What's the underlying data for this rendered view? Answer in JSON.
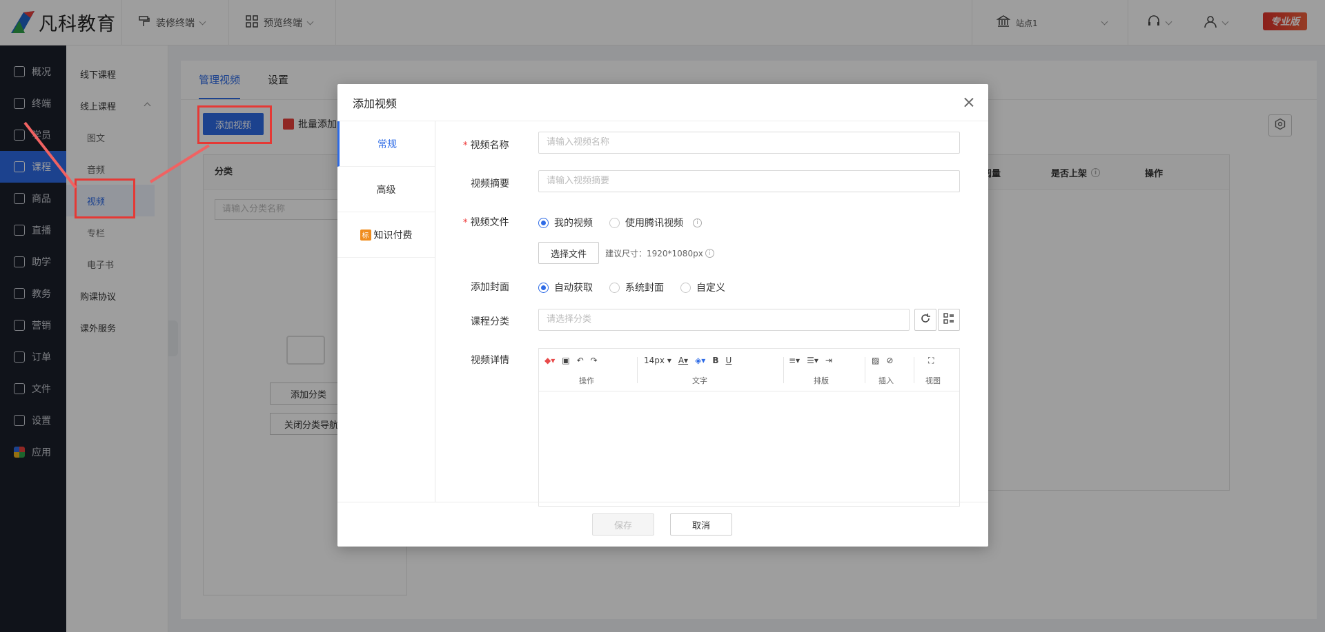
{
  "header": {
    "logo_text": "凡科教育",
    "decorate_label": "装修终端",
    "preview_label": "预览终端",
    "site_label": "站点1",
    "edition_badge": "专业版"
  },
  "nav": {
    "items": [
      {
        "label": "概况"
      },
      {
        "label": "终端"
      },
      {
        "label": "学员"
      },
      {
        "label": "课程"
      },
      {
        "label": "商品"
      },
      {
        "label": "直播"
      },
      {
        "label": "助学"
      },
      {
        "label": "教务"
      },
      {
        "label": "营销"
      },
      {
        "label": "订单"
      },
      {
        "label": "文件"
      },
      {
        "label": "设置"
      },
      {
        "label": "应用"
      }
    ],
    "active": "课程"
  },
  "subnav": {
    "offline": "线下课程",
    "online": "线上课程",
    "children": [
      "图文",
      "音频",
      "视频",
      "专栏",
      "电子书"
    ],
    "purchase": "购课协议",
    "extra": "课外服务"
  },
  "main": {
    "tabs": [
      "管理视频",
      "设置"
    ],
    "add_video": "添加视频",
    "batch_add": "批量添加",
    "category_header": "分类",
    "category_search_placeholder": "请输入分类名称",
    "add_category": "添加分类",
    "close_category_nav": "关闭分类导航",
    "columns": [
      "实际订阅量",
      "是否上架",
      "操作"
    ]
  },
  "modal": {
    "title": "添加视频",
    "side_tabs": [
      "常规",
      "高级",
      "知识付费"
    ],
    "knowledge_tag": "标",
    "fields": {
      "name_label": "视频名称",
      "name_placeholder": "请输入视频名称",
      "summary_label": "视频摘要",
      "summary_placeholder": "请输入视频摘要",
      "file_label": "视频文件",
      "file_options": [
        "我的视频",
        "使用腾讯视频"
      ],
      "choose_file": "选择文件",
      "size_hint": "建议尺寸：1920*1080px",
      "cover_label": "添加封面",
      "cover_options": [
        "自动获取",
        "系统封面",
        "自定义"
      ],
      "category_label": "课程分类",
      "category_placeholder": "请选择分类",
      "detail_label": "视频详情"
    },
    "editor": {
      "font_size": "14px",
      "captions": [
        "操作",
        "文字",
        "排版",
        "插入",
        "视图"
      ]
    },
    "save": "保存",
    "cancel": "取消"
  },
  "colors": {
    "primary": "#2e6be6",
    "highlight": "#e53935",
    "nav_bg": "#1a1f2b"
  }
}
